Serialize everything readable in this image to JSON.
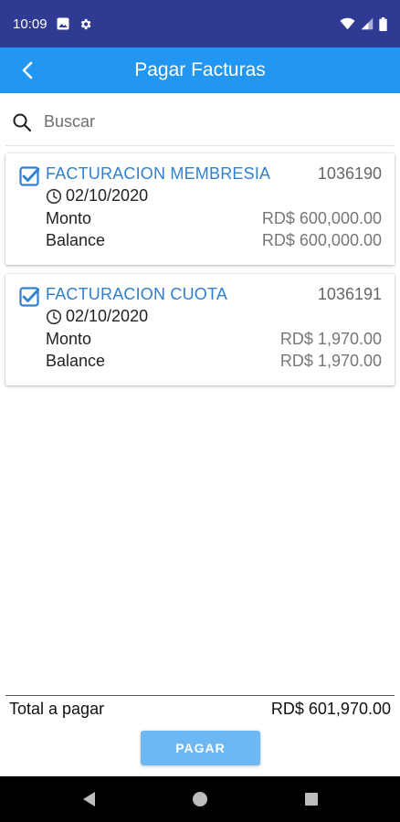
{
  "status_bar": {
    "time": "10:09",
    "left_icons": [
      "image-icon",
      "gear-icon"
    ],
    "right_icons": [
      "wifi-icon",
      "signal-icon",
      "battery-icon"
    ]
  },
  "app_bar": {
    "title": "Pagar Facturas",
    "back_icon": "arrow-back-icon",
    "color": "#2196f3"
  },
  "search": {
    "placeholder": "Buscar",
    "value": ""
  },
  "invoices": [
    {
      "title": "FACTURACION MEMBRESIA",
      "number": "1036190",
      "date": "02/10/2020",
      "checked": true,
      "monto_label": "Monto",
      "monto": "RD$ 600,000.00",
      "balance_label": "Balance",
      "balance": "RD$ 600,000.00"
    },
    {
      "title": "FACTURACION CUOTA",
      "number": "1036191",
      "date": "02/10/2020",
      "checked": true,
      "monto_label": "Monto",
      "monto": "RD$ 1,970.00",
      "balance_label": "Balance",
      "balance": "RD$ 1,970.00"
    }
  ],
  "footer": {
    "total_label": "Total a pagar",
    "total_value": "RD$ 601,970.00",
    "pay_button": "PAGAR"
  },
  "colors": {
    "status_bar": "#2f3a93",
    "accent": "#2196f3",
    "invoice_title": "#2f80d0",
    "pay_button": "#6db7f3"
  }
}
